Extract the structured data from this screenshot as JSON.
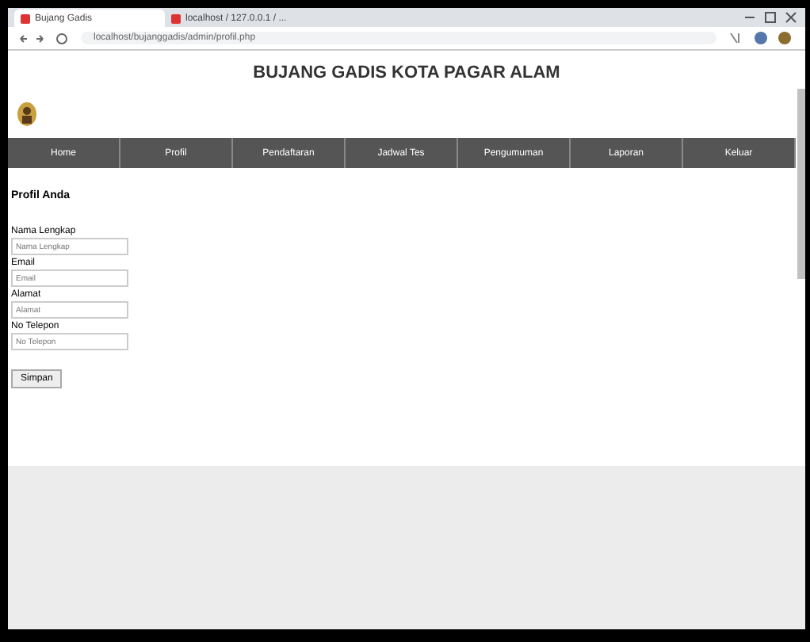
{
  "browser": {
    "tabs": [
      {
        "label": "Bujang Gadis",
        "selected": true
      },
      {
        "label": "localhost / 127.0.0.1 / ...",
        "selected": false
      }
    ],
    "address": "localhost/bujanggadis/admin/profil.php"
  },
  "page": {
    "title": "BUJANG GADIS KOTA PAGAR ALAM",
    "nav": [
      {
        "label": "Home"
      },
      {
        "label": "Profil"
      },
      {
        "label": "Pendaftaran"
      },
      {
        "label": "Jadwal Tes"
      },
      {
        "label": "Pengumuman"
      },
      {
        "label": "Laporan"
      },
      {
        "label": "Keluar"
      }
    ],
    "form": {
      "heading": "Profil Anda",
      "fields": [
        {
          "label": "Nama Lengkap",
          "placeholder": "Nama Lengkap"
        },
        {
          "label": "Email",
          "placeholder": "Email"
        },
        {
          "label": "Alamat",
          "placeholder": "Alamat"
        },
        {
          "label": "No Telepon",
          "placeholder": "No Telepon"
        }
      ],
      "button": "Simpan"
    }
  }
}
